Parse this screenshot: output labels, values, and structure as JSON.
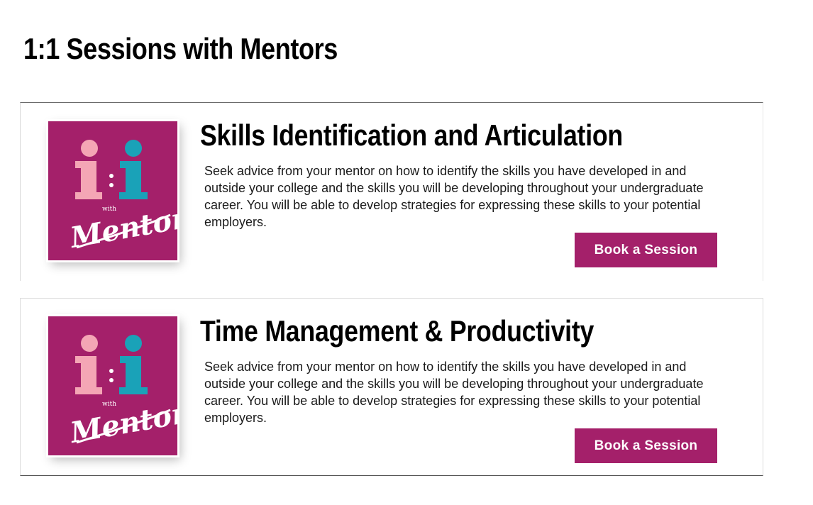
{
  "page": {
    "title": "1:1 Sessions with Mentors"
  },
  "logo": {
    "icon": "one-to-one-with-mentor-logo",
    "colors": {
      "background": "#a4206a",
      "pink": "#f4a6b5",
      "teal": "#1aa2b8",
      "white": "#ffffff"
    },
    "small_text": "with",
    "script_text": "Mentor"
  },
  "sessions": [
    {
      "title": "Skills Identification and Articulation",
      "description": "Seek advice from your mentor on how to identify the skills you have developed in and outside your college and the skills you will be developing throughout your undergraduate career. You will be able to develop strategies for expressing these skills to your potential employers.",
      "button_label": "Book a Session"
    },
    {
      "title": "Time Management & Productivity",
      "description": "Seek advice from your mentor on how to identify the skills you have developed in and outside your college and the skills you will be developing throughout your undergraduate career. You will be able to develop strategies for expressing these skills to your potential employers.",
      "button_label": "Book a Session"
    }
  ],
  "colors": {
    "accent": "#a4206a",
    "text": "#000000"
  }
}
